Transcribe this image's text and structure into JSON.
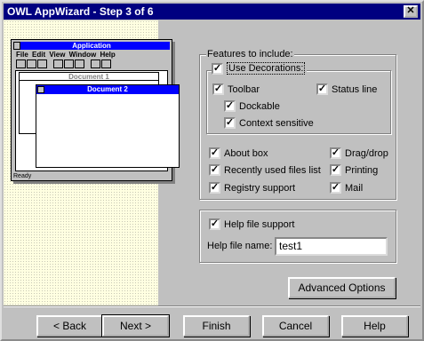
{
  "window": {
    "title": "OWL AppWizard - Step 3 of 6",
    "close_glyph": "✕"
  },
  "preview": {
    "app_title": "Application",
    "menu": "File Edit View Window Help",
    "doc1_title": "Document 1",
    "doc2_title": "Document 2",
    "status": "Ready"
  },
  "features": {
    "legend": "Features to include:",
    "use_decorations": "Use Decorations:",
    "toolbar": "Toolbar",
    "status_line": "Status line",
    "dockable": "Dockable",
    "context_sensitive": "Context sensitive",
    "about_box": "About box",
    "drag_drop": "Drag/drop",
    "recent_files": "Recently used files list",
    "printing": "Printing",
    "registry": "Registry support",
    "mail": "Mail",
    "check_glyph": "✓"
  },
  "help": {
    "help_support": "Help file support",
    "file_name_label": "Help file name:",
    "file_name_value": "test1"
  },
  "buttons": {
    "advanced": "Advanced Options",
    "back": "< Back",
    "next": "Next >",
    "finish": "Finish",
    "cancel": "Cancel",
    "help": "Help"
  }
}
